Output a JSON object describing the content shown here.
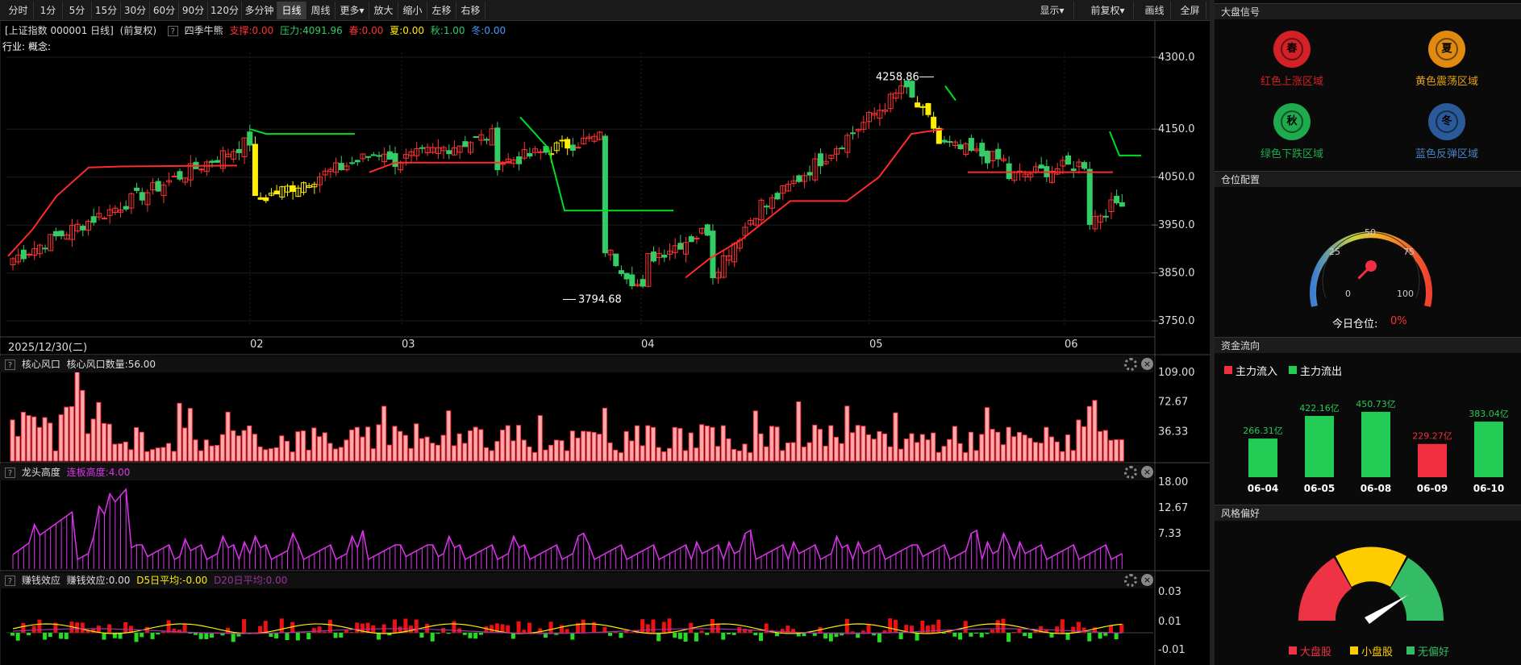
{
  "toolbar": {
    "periods": [
      "分时",
      "1分",
      "5分",
      "15分",
      "30分",
      "60分",
      "90分",
      "120分",
      "多分钟",
      "日线",
      "周线",
      "更多▾",
      "放大",
      "缩小",
      "左移",
      "右移"
    ],
    "active": "日线",
    "right": [
      "显示▾",
      "前复权▾",
      "画线",
      "全屏"
    ]
  },
  "main": {
    "title": "[上证指数 000001 日线]",
    "adjust": "(前复权)",
    "indicator": "四季牛熊",
    "support": "支撑:0.00",
    "pressure": "压力:4091.96",
    "spring": "春:0.00",
    "summer": "夏:0.00",
    "autumn": "秋:1.00",
    "winter": "冬:0.00",
    "industry": "行业:",
    "concept": "概念:",
    "y_ticks": [
      "4300.0",
      "4150.0",
      "4050.0",
      "3950.0",
      "3850.0",
      "3750.0"
    ],
    "high_label": "4258.86",
    "low_label": "3794.68",
    "date_axis": [
      "2025/12/30(二)",
      "02",
      "03",
      "04",
      "05",
      "06"
    ]
  },
  "panel1": {
    "title": "核心风口",
    "desc": "核心风口数量:56.00",
    "y_ticks": [
      "109.00",
      "72.67",
      "36.33"
    ]
  },
  "panel2": {
    "title": "龙头高度",
    "desc": "连板高度:4.00",
    "y_ticks": [
      "18.00",
      "12.67",
      "7.33"
    ]
  },
  "panel3": {
    "title": "赚钱效应",
    "desc": "赚钱效应:0.00",
    "d5": "D5日平均:-0.00",
    "d20": "D20日平均:0.00",
    "y_ticks": [
      "0.03",
      "0.01",
      "-0.01"
    ]
  },
  "signals": {
    "header": "大盘信号",
    "items": [
      {
        "glyph": "春",
        "label": "红色上涨区域",
        "color": "#d42027"
      },
      {
        "glyph": "夏",
        "label": "黄色震荡区域",
        "color": "#e08a10"
      },
      {
        "glyph": "秋",
        "label": "绿色下跌区域",
        "color": "#1faa4d"
      },
      {
        "glyph": "冬",
        "label": "蓝色反弹区域",
        "color": "#2a5a9a"
      }
    ]
  },
  "position": {
    "header": "仓位配置",
    "ticks": [
      "0",
      "25",
      "50",
      "75",
      "100"
    ],
    "label": "今日仓位:",
    "value": "0%",
    "level": 0
  },
  "capital": {
    "header": "资金流向",
    "legend_in": "主力流入",
    "legend_out": "主力流出",
    "bars": [
      {
        "date": "06-04",
        "value": 266.31,
        "label": "266.31亿",
        "dir": "out"
      },
      {
        "date": "06-05",
        "value": 422.16,
        "label": "422.16亿",
        "dir": "out"
      },
      {
        "date": "06-08",
        "value": 450.73,
        "label": "450.73亿",
        "dir": "out"
      },
      {
        "date": "06-09",
        "value": 229.27,
        "label": "229.27亿",
        "dir": "in"
      },
      {
        "date": "06-10",
        "value": 383.04,
        "label": "383.04亿",
        "dir": "out"
      }
    ]
  },
  "style": {
    "header": "风格偏好",
    "legend": [
      "大盘股",
      "小盘股",
      "无偏好"
    ]
  },
  "colors": {
    "up": "#ff3333",
    "down": "#33cc66",
    "yellow": "#ffee00",
    "support": "#ff2a2a",
    "pressure": "#00dd22",
    "magenta": "#dd33ee"
  }
}
